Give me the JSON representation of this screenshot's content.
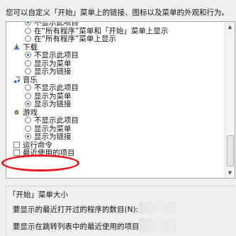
{
  "description": "您可以自定义「开始」菜单上的链接、图标以及菜单的外观和行为。",
  "options": [
    {
      "type": "radio",
      "label": "不显示此项目",
      "checked": true
    },
    {
      "type": "radio",
      "label": "在“所有程序”菜单和「开始」菜单上显示",
      "checked": false
    },
    {
      "type": "radio",
      "label": "在“所有程序”菜单上显示",
      "checked": false
    },
    {
      "type": "category",
      "label": "下载",
      "icon": "download-icon"
    },
    {
      "type": "radio",
      "label": "不显示此项目",
      "checked": true
    },
    {
      "type": "radio",
      "label": "显示为菜单",
      "checked": false
    },
    {
      "type": "radio",
      "label": "显示为链接",
      "checked": false
    },
    {
      "type": "category",
      "label": "音乐",
      "icon": "music-icon"
    },
    {
      "type": "radio",
      "label": "不显示此项目",
      "checked": false
    },
    {
      "type": "radio",
      "label": "显示为菜单",
      "checked": false
    },
    {
      "type": "radio",
      "label": "显示为链接",
      "checked": true
    },
    {
      "type": "category",
      "label": "游戏",
      "icon": "games-icon"
    },
    {
      "type": "radio",
      "label": "不显示此项目",
      "checked": false
    },
    {
      "type": "radio",
      "label": "显示为菜单",
      "checked": false
    },
    {
      "type": "radio",
      "label": "显示为链接",
      "checked": true
    },
    {
      "type": "checkbox",
      "label": "运行命令",
      "checked": false
    },
    {
      "type": "checkbox",
      "label": "最近使用的项目",
      "checked": false
    }
  ],
  "size_group": {
    "title": "「开始」菜单大小",
    "recent_programs_label": "要显示的最近打开过的程序的数目(N):",
    "jump_list_label": "要显示在跳转列表中的最近使用的项目数(J):"
  },
  "colors": {
    "highlight_ellipse": "#e8161e",
    "radio_dot": "#2a5cae"
  }
}
